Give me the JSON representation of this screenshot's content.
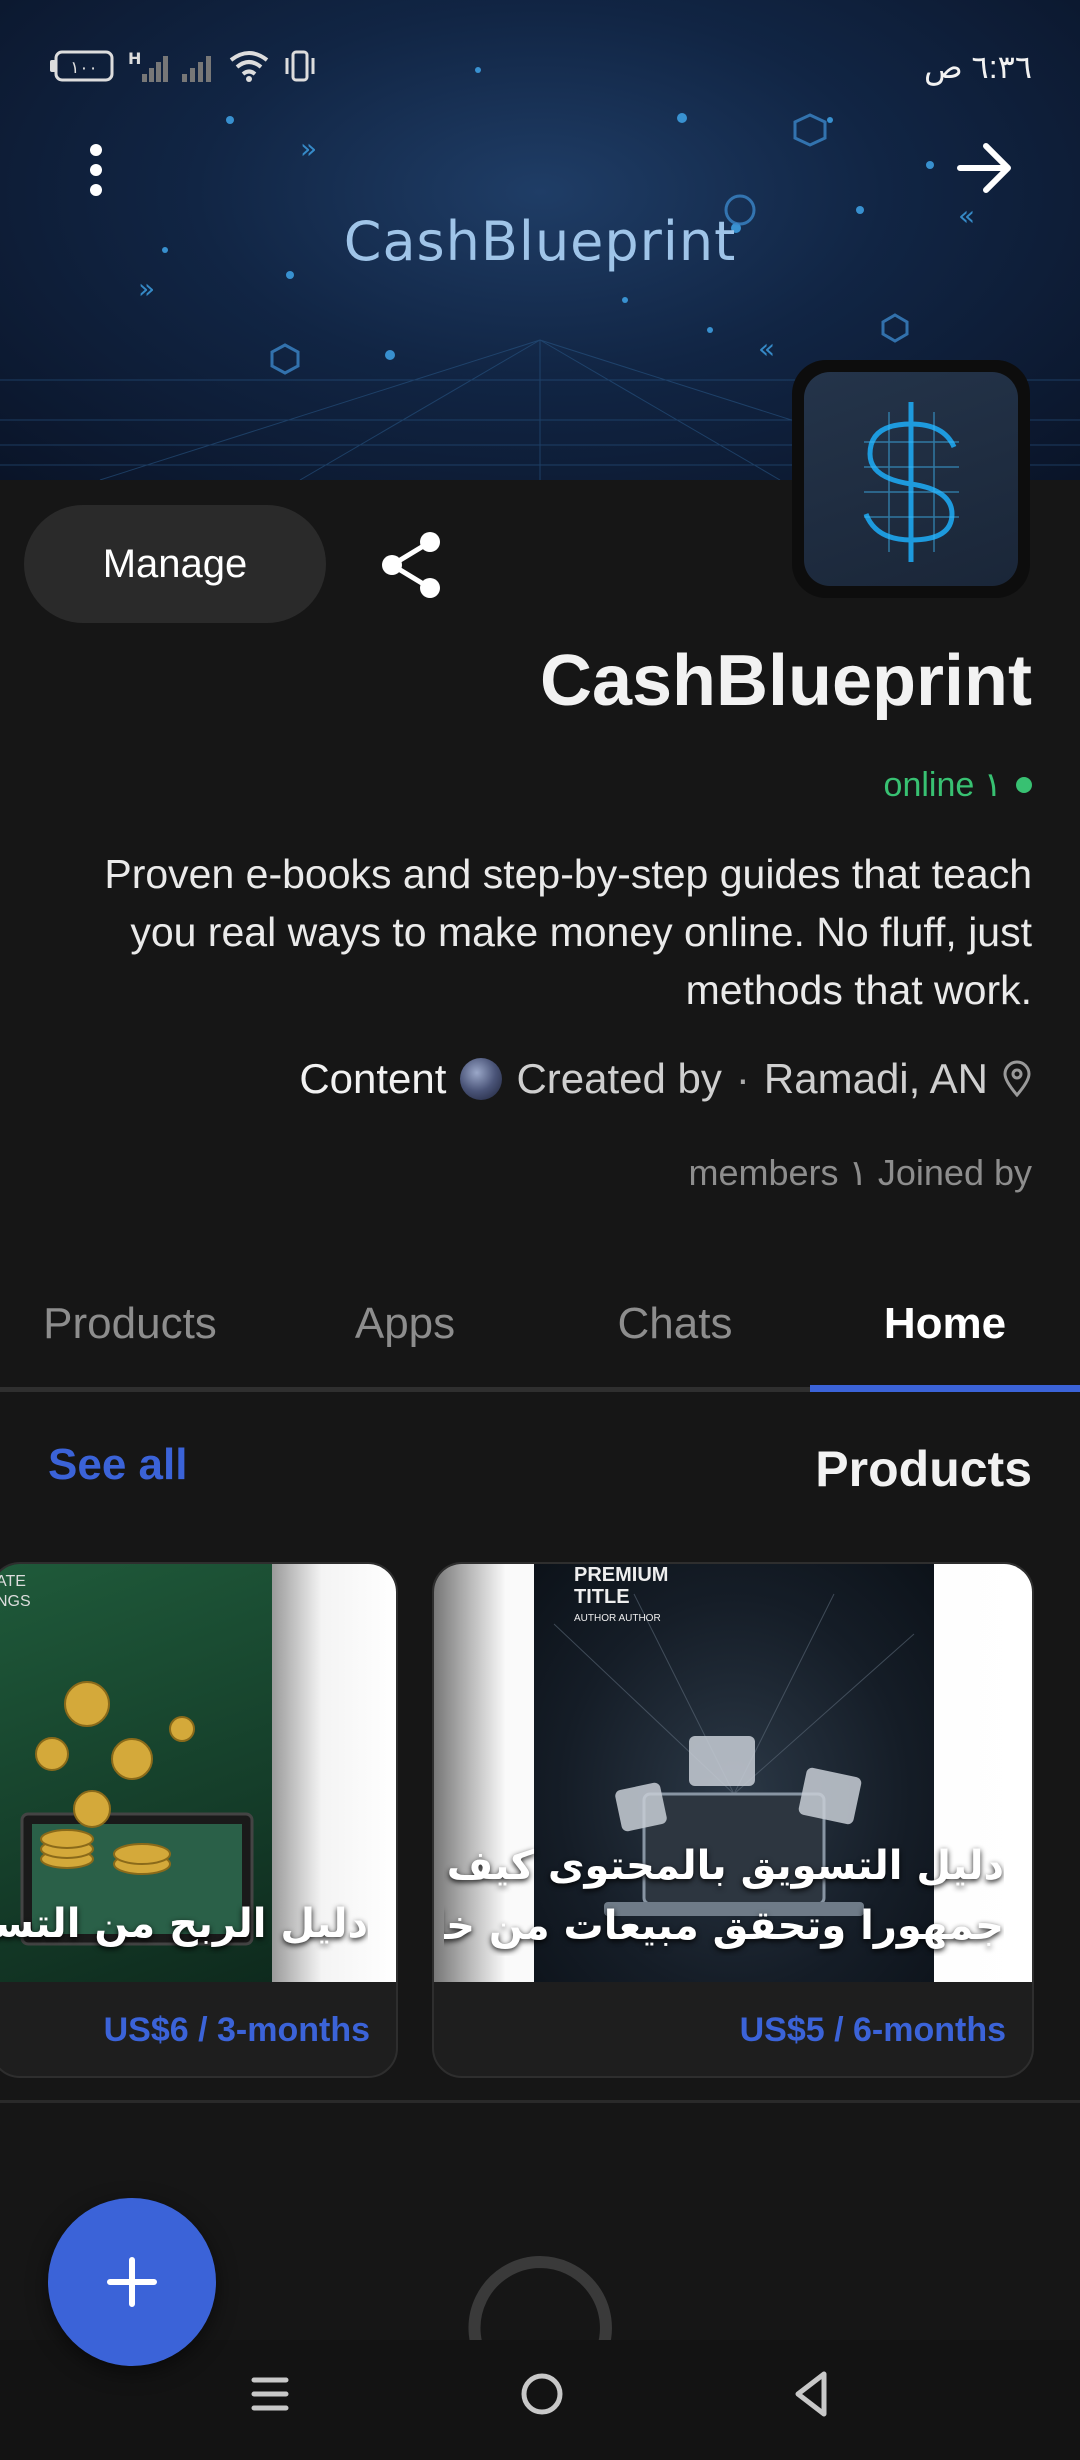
{
  "status_bar": {
    "time": "٦:٣٦ ص",
    "battery": "١٠٠",
    "network": "H"
  },
  "cover": {
    "title": "CashBlueprint"
  },
  "actions": {
    "manage_label": "Manage"
  },
  "profile": {
    "title": "CashBlueprint",
    "online_text": "online ١",
    "description": "Proven e-books and step-by-step guides that teach you real ways to make money online. No fluff, just methods that work.",
    "meta": {
      "content_label": "Content",
      "created_by_label": "Created by",
      "separator": "·",
      "location": "Ramadi, AN"
    },
    "joined_text": "members ١ Joined by"
  },
  "tabs": [
    {
      "label": "Products",
      "active": false
    },
    {
      "label": "Apps",
      "active": false
    },
    {
      "label": "Chats",
      "active": false
    },
    {
      "label": "Home",
      "active": true
    }
  ],
  "section": {
    "title": "Products",
    "see_all_label": "See all"
  },
  "products": [
    {
      "title_line1": "دليل التسويق بالمحتوى كيف تبني",
      "title_line2": "جمهورا وتحقق مبيعات من خلال ا...",
      "price": "US$5 / 6-months",
      "cover_text_1": "PREMIUM",
      "cover_text_2": "TITLE",
      "cover_text_3": "AUTHOR AUTHOR"
    },
    {
      "title_line1": "دليل الربح من التسويق با",
      "price": "US$6 / 3-months",
      "cover_text_1": "ATE",
      "cover_text_2": "NGS"
    }
  ],
  "colors": {
    "accent": "#3b63d8",
    "online": "#38c172",
    "background": "#161616"
  },
  "icons": {
    "menu": "kebab-menu-icon",
    "forward": "arrow-right-icon",
    "share": "share-icon",
    "location": "location-pin-icon",
    "fab": "plus-icon",
    "chat": "chat-bubble-icon"
  }
}
